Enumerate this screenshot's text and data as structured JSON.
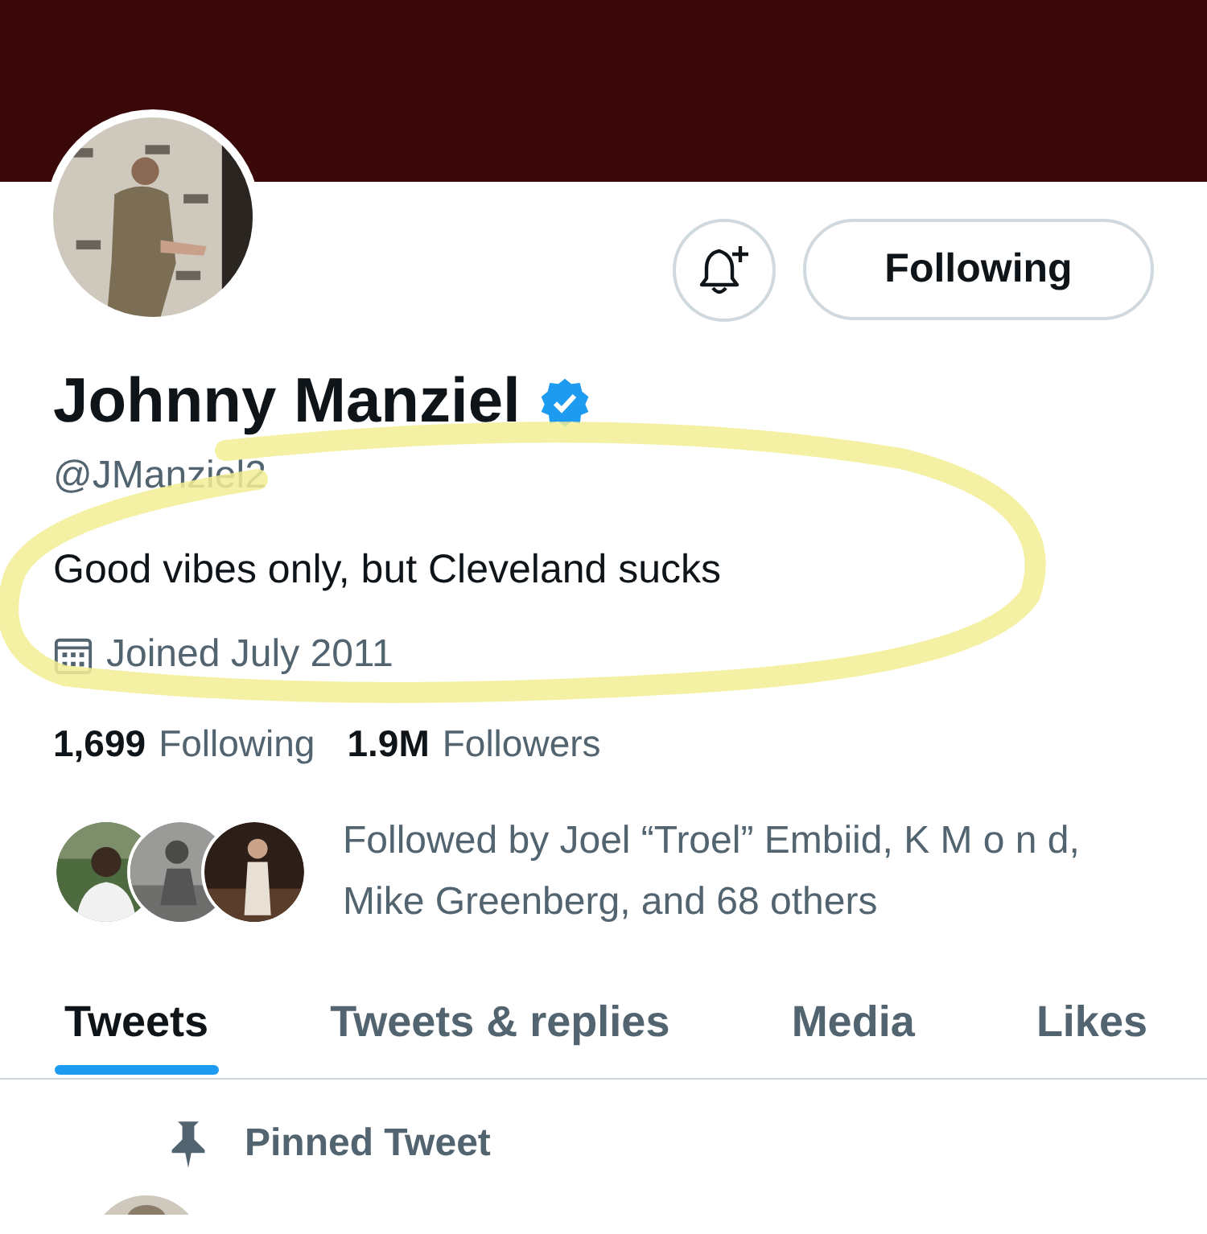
{
  "profile": {
    "name": "Johnny Manziel",
    "verified": true,
    "handle": "@JManziel2",
    "bio": "Good vibes only, but Cleveland sucks",
    "joined": "Joined July 2011"
  },
  "actions": {
    "follow_button": "Following"
  },
  "stats": [
    {
      "count": "1,699",
      "label": "Following"
    },
    {
      "count": "1.9M",
      "label": "Followers"
    }
  ],
  "followed_by": "Followed by Joel “Troel” Embiid, K M o n d, Mike Greenberg, and 68 others",
  "tabs": [
    {
      "label": "Tweets",
      "selected": true
    },
    {
      "label": "Tweets & replies",
      "selected": false
    },
    {
      "label": "Media",
      "selected": false
    },
    {
      "label": "Likes",
      "selected": false
    }
  ],
  "pinned": {
    "label": "Pinned Tweet"
  }
}
